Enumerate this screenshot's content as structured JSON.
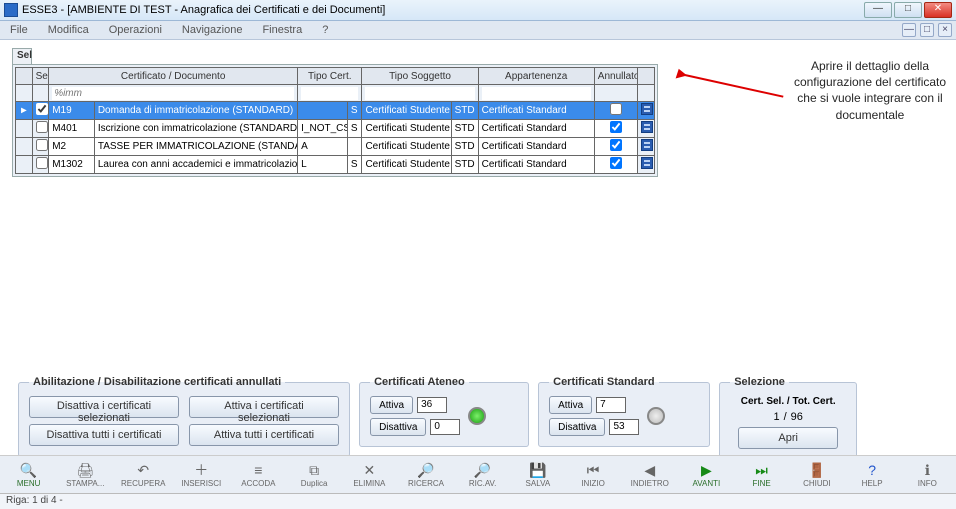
{
  "window": {
    "title": "ESSE3 - [AMBIENTE DI TEST - Anagrafica dei Certificati e dei Documenti]"
  },
  "menu": {
    "file": "File",
    "modifica": "Modifica",
    "operazioni": "Operazioni",
    "navigazione": "Navigazione",
    "finestra": "Finestra",
    "help": "?"
  },
  "tab": {
    "label": "Sel"
  },
  "headers": {
    "sel": "Sel",
    "certdoc": "Certificato / Documento",
    "tipocert": "Tipo Cert.",
    "tiposogg": "Tipo Soggetto",
    "appart": "Appartenenza",
    "annullato": "Annullato"
  },
  "filter": {
    "certdoc": "%imm"
  },
  "rows": [
    {
      "sel": true,
      "code": "M19",
      "desc": "Domanda di immatricolazione (STANDARD)",
      "tipocert": "",
      "tc2": "S",
      "tiposogg": "Certificati Studente",
      "sogg2": "STD",
      "appart": "Certificati Standard",
      "annullato": false,
      "selected": true
    },
    {
      "sel": false,
      "code": "M401",
      "desc": "Iscrizione con immatricolazione (STANDARD)",
      "tipocert": "I_NOT_CS",
      "tc2": "S",
      "tiposogg": "Certificati Studente",
      "sogg2": "STD",
      "appart": "Certificati Standard",
      "annullato": true,
      "selected": false
    },
    {
      "sel": false,
      "code": "M2",
      "desc": "TASSE PER IMMATRICOLAZIONE (STANDARD)",
      "tipocert": "A",
      "tc2": "",
      "tiposogg": "Certificati Studente",
      "sogg2": "STD",
      "appart": "Certificati Standard",
      "annullato": true,
      "selected": false
    },
    {
      "sel": false,
      "code": "M1302",
      "desc": "Laurea con anni accademici e immatricolazione",
      "tipocert": "L",
      "tc2": "S",
      "tiposogg": "Certificati Studente",
      "sogg2": "STD",
      "appart": "Certificati Standard",
      "annullato": true,
      "selected": false
    }
  ],
  "annotation": "Aprire il dettaglio della configurazione del certificato che si vuole integrare con il documentale",
  "abil": {
    "legend": "Abilitazione / Disabilitazione certificati annullati",
    "disattiva_sel": "Disattiva i certificati selezionati",
    "attiva_sel": "Attiva i certificati selezionati",
    "disattiva_tutti": "Disattiva tutti i certificati",
    "attiva_tutti": "Attiva tutti i certificati"
  },
  "ateneo": {
    "legend": "Certificati Ateneo",
    "attiva": "Attiva",
    "disattiva": "Disattiva",
    "att_val": "36",
    "dis_val": "0"
  },
  "standard": {
    "legend": "Certificati Standard",
    "attiva": "Attiva",
    "disattiva": "Disattiva",
    "att_val": "7",
    "dis_val": "53"
  },
  "selezione": {
    "legend": "Selezione",
    "label": "Cert. Sel. / Tot. Cert.",
    "sel": "1",
    "sep": "/",
    "tot": "96",
    "apri": "Apri"
  },
  "toolbar": {
    "menu": "MENU",
    "stampa": "STAMPA...",
    "recupera": "RECUPERA",
    "inserisci": "INSERISCI",
    "accoda": "ACCODA",
    "duplica": "Duplica",
    "elimina": "ELIMINA",
    "ricerca": "RICERCA",
    "ricav": "RIC.AV.",
    "salva": "SALVA",
    "inizio": "INIZIO",
    "indietro": "INDIETRO",
    "avanti": "AVANTI",
    "fine": "FINE",
    "chiudi": "CHIUDI",
    "help": "HELP",
    "info": "INFO"
  },
  "status": {
    "text": "Riga: 1 di 4 -"
  }
}
